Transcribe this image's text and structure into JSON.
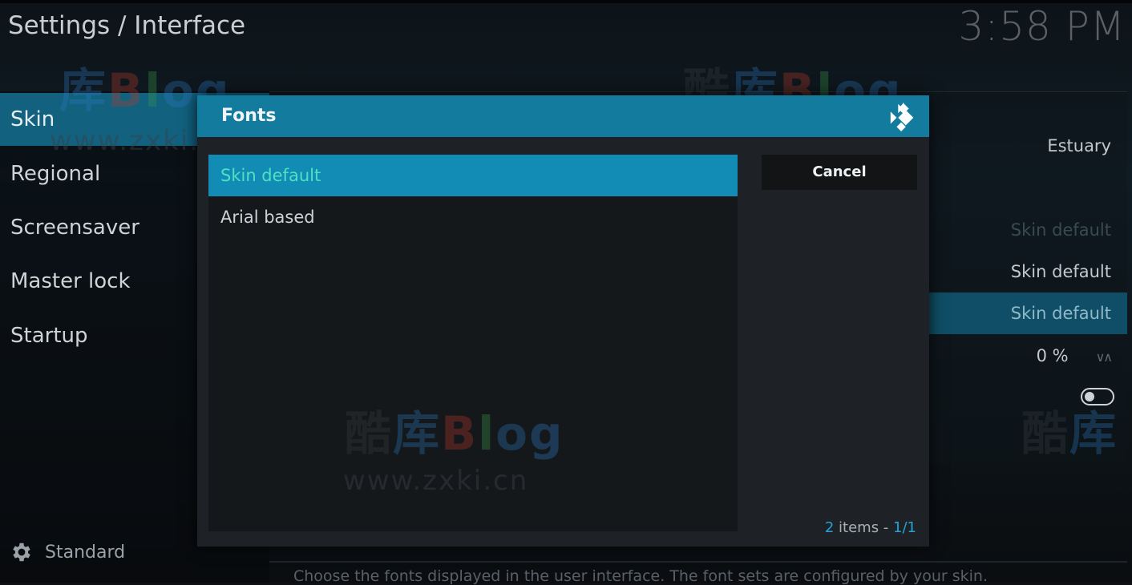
{
  "header": {
    "breadcrumb": "Settings / Interface",
    "clock": "3:58 PM"
  },
  "sidebar": {
    "items": [
      {
        "label": "Skin",
        "active": true
      },
      {
        "label": "Regional"
      },
      {
        "label": "Screensaver"
      },
      {
        "label": "Master lock"
      },
      {
        "label": "Startup"
      }
    ],
    "footer_label": "Standard",
    "footer_icon": "gear-icon"
  },
  "settings": {
    "skin_value": "Estuary",
    "theme_value": "Skin default",
    "colours_value": "Skin default",
    "fonts_value": "Skin default",
    "zoom_value": "0 %",
    "description": "Choose the fonts displayed in the user interface. The font sets are configured by your skin."
  },
  "dialog": {
    "title": "Fonts",
    "logo_icon": "kodi-logo-icon",
    "options": [
      {
        "label": "Skin default",
        "selected": true
      },
      {
        "label": "Arial based",
        "selected": false
      }
    ],
    "cancel_label": "Cancel",
    "count_number": "2",
    "count_text": " items - ",
    "count_page": "1/1"
  },
  "watermark": {
    "ku": "酷",
    "ku2": "库",
    "b": "B",
    "l": "l",
    "o": "o",
    "g": "g",
    "url": "www.zxki.cn"
  },
  "colors": {
    "accent": "#138cb5",
    "header": "#137c9e",
    "selected_text": "#4fe0c4"
  }
}
